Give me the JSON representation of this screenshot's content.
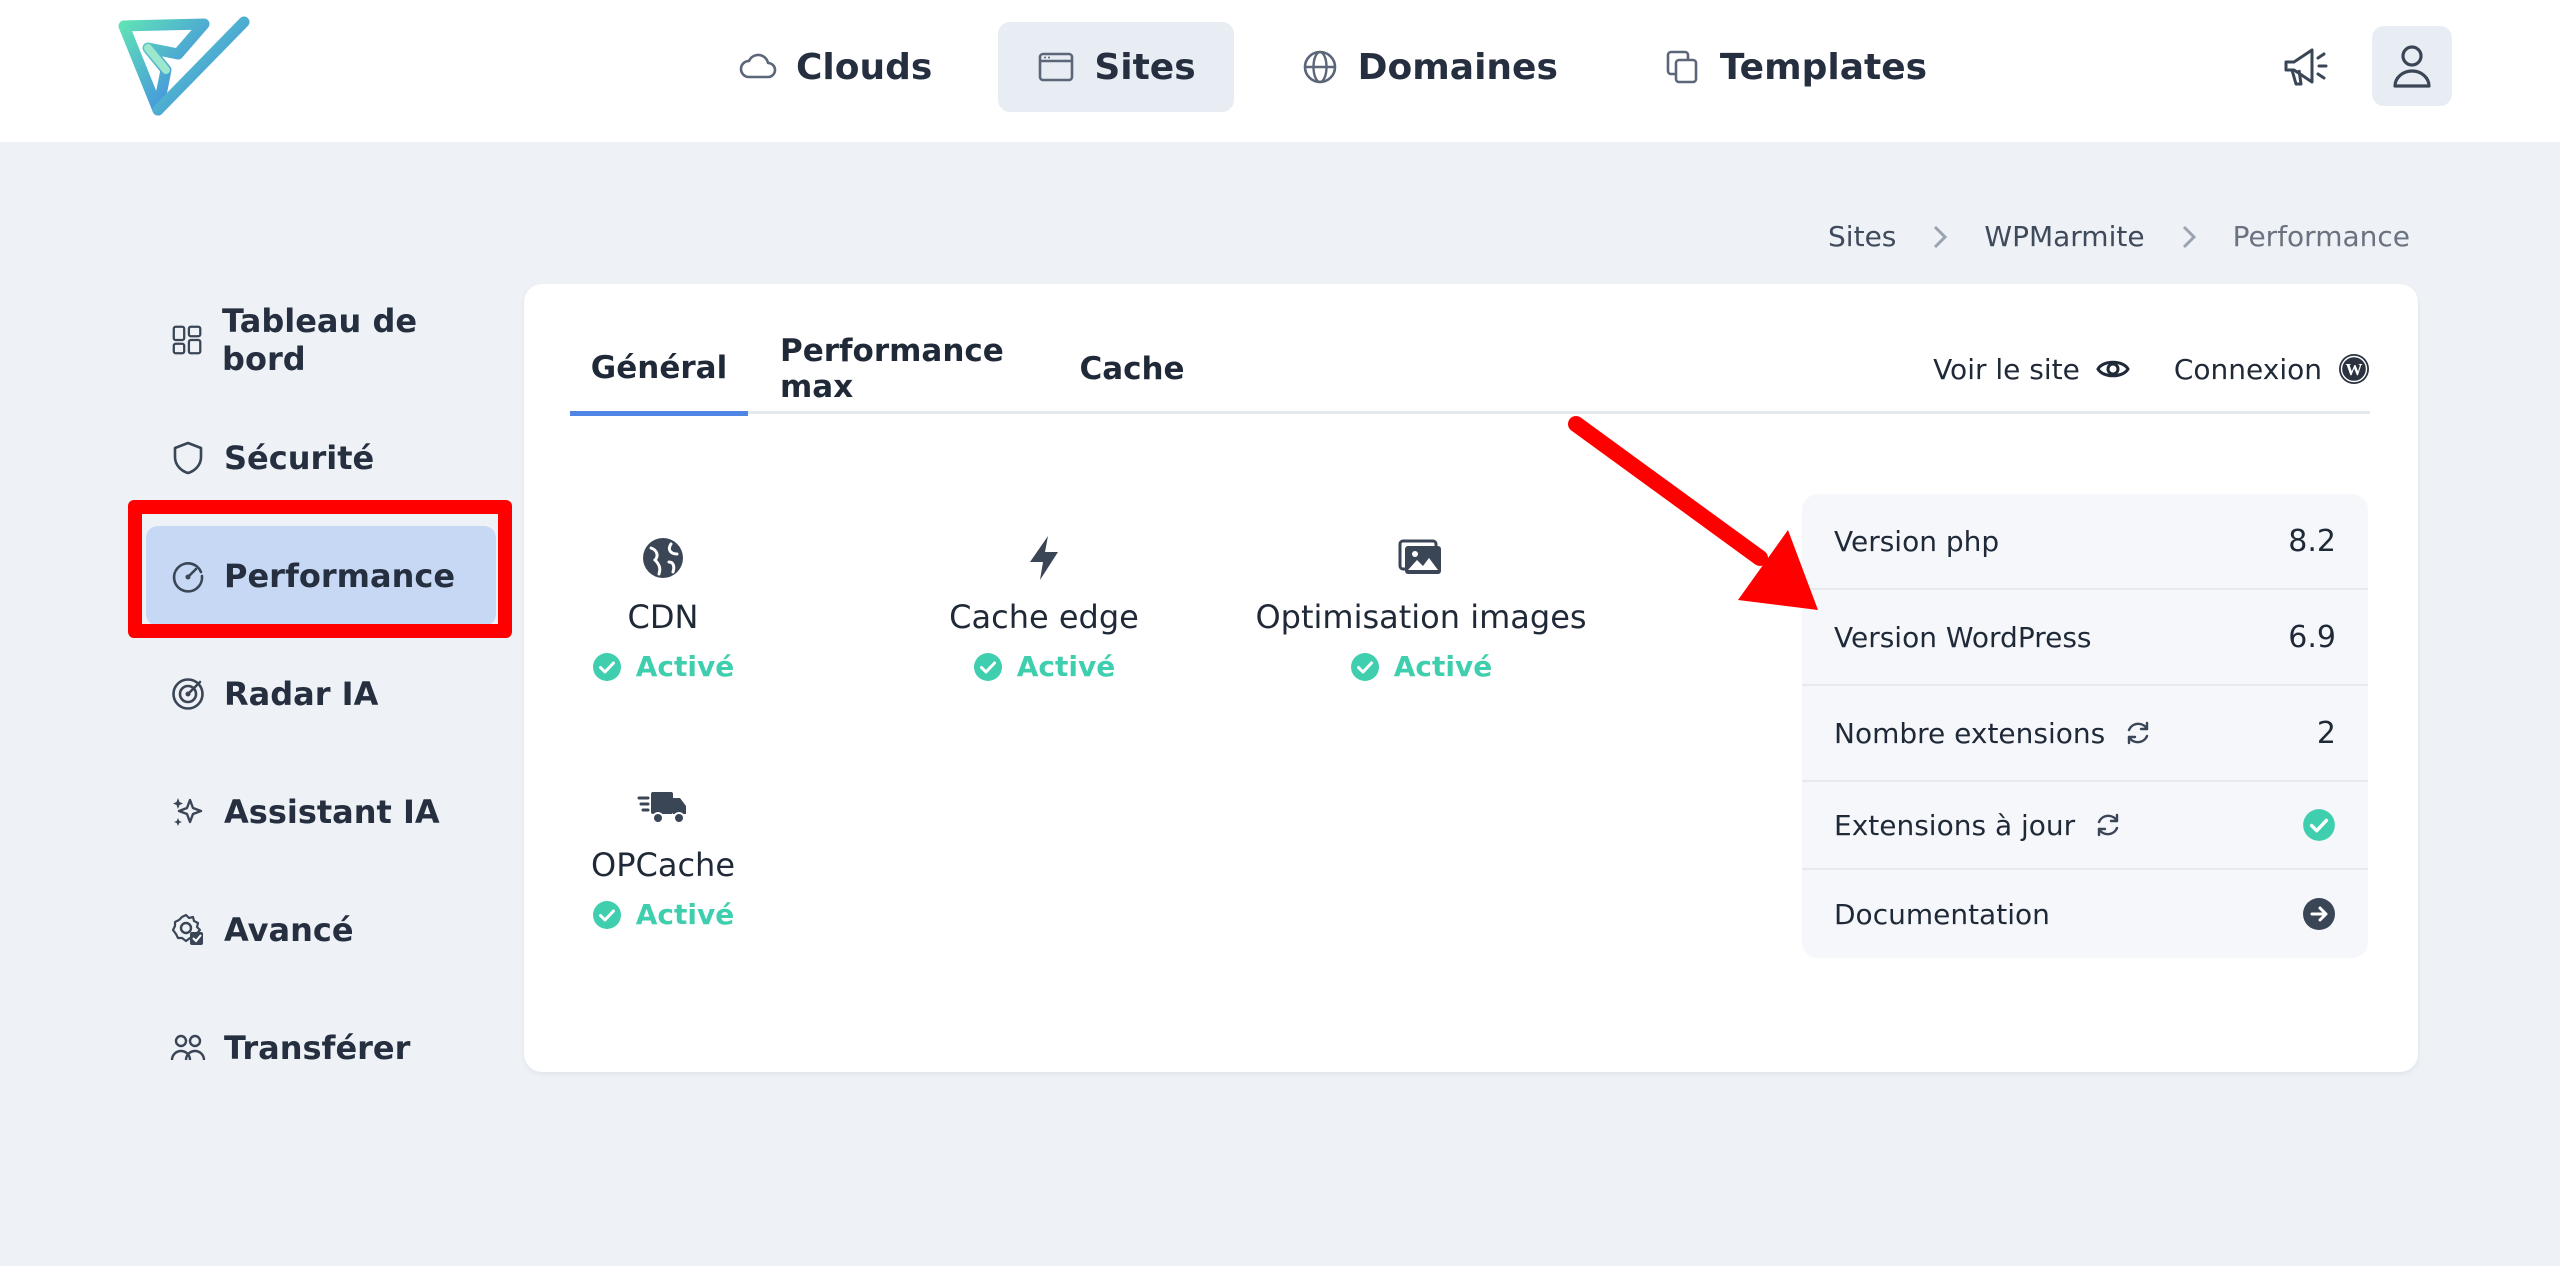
{
  "nav": {
    "items": [
      {
        "label": "Clouds",
        "icon": "cloud-icon",
        "active": false
      },
      {
        "label": "Sites",
        "icon": "browser-window-icon",
        "active": true
      },
      {
        "label": "Domaines",
        "icon": "globe-icon",
        "active": false
      },
      {
        "label": "Templates",
        "icon": "copy-icon",
        "active": false
      }
    ]
  },
  "breadcrumb": [
    "Sites",
    "WPMarmite",
    "Performance"
  ],
  "sidebar": {
    "items": [
      {
        "label": "Tableau de bord",
        "icon": "dashboard-icon"
      },
      {
        "label": "Sécurité",
        "icon": "shield-icon"
      },
      {
        "label": "Performance",
        "icon": "gauge-icon",
        "active": true
      },
      {
        "label": "Radar IA",
        "icon": "radar-icon"
      },
      {
        "label": "Assistant IA",
        "icon": "sparkles-icon"
      },
      {
        "label": "Avancé",
        "icon": "settings-gear-icon"
      },
      {
        "label": "Transférer",
        "icon": "users-transfer-icon"
      }
    ]
  },
  "tabs": [
    "Général",
    "Performance max",
    "Cache"
  ],
  "tab_actions": {
    "view_site": "Voir le site",
    "login": "Connexion"
  },
  "features": [
    {
      "name": "CDN",
      "status": "Activé",
      "icon": "globe-solid-icon"
    },
    {
      "name": "Cache edge",
      "status": "Activé",
      "icon": "lightning-icon"
    },
    {
      "name": "Optimisation images",
      "status": "Activé",
      "icon": "images-icon"
    },
    {
      "name": "OPCache",
      "status": "Activé",
      "icon": "delivery-truck-icon"
    }
  ],
  "info": {
    "php_label": "Version php",
    "php_value": "8.2",
    "wp_label": "Version WordPress",
    "wp_value": "6.9",
    "ext_label": "Nombre extensions",
    "ext_value": "2",
    "ext_uptodate_label": "Extensions à jour",
    "doc_label": "Documentation"
  },
  "colors": {
    "accent": "#4f86e6",
    "success": "#3fcfae",
    "highlight": "#ff0000",
    "active_side": "#c7d8f5"
  }
}
